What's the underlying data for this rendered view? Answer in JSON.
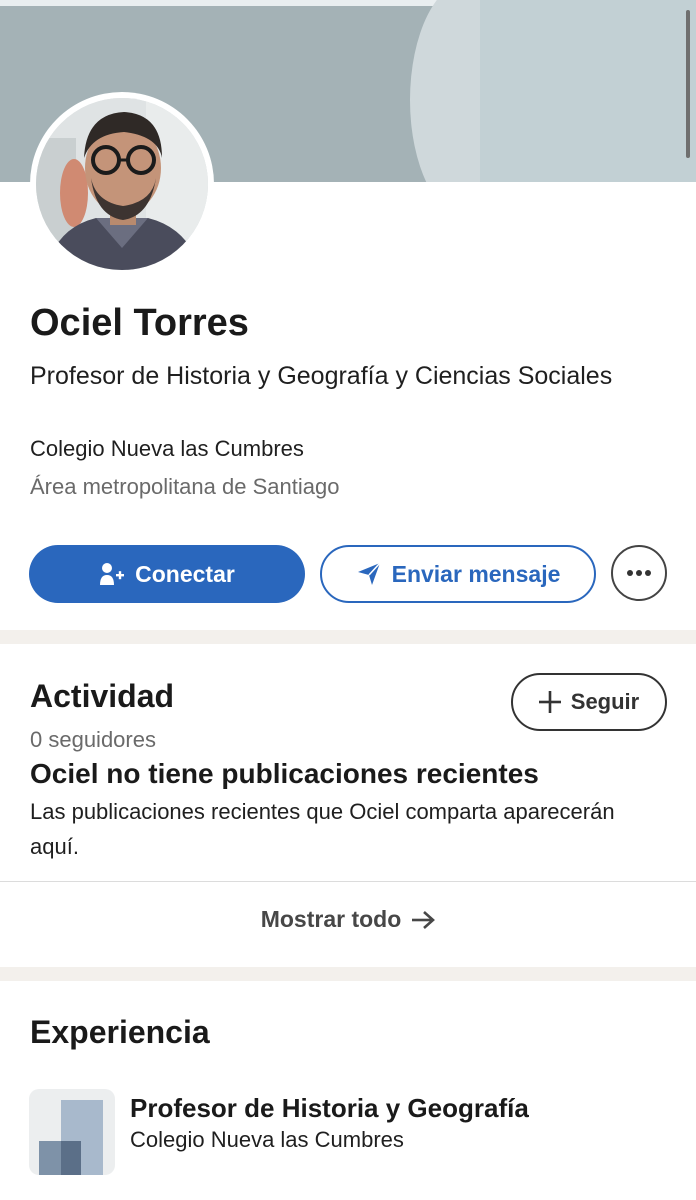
{
  "profile": {
    "name": "Ociel Torres",
    "headline": "Profesor de Historia y Geografía y Ciencias Sociales",
    "company": "Colegio Nueva las Cumbres",
    "location": "Área metropolitana de Santiago"
  },
  "actions": {
    "connect_label": "Conectar",
    "message_label": "Enviar mensaje",
    "more_icon": "ellipsis-icon"
  },
  "activity": {
    "title": "Actividad",
    "follow_label": "Seguir",
    "followers": "0 seguidores",
    "empty_title": "Ociel no tiene publicaciones recientes",
    "empty_desc": "Las publicaciones recientes que Ociel comparta aparecerán aquí.",
    "show_all_label": "Mostrar todo"
  },
  "experience": {
    "title": "Experiencia",
    "items": [
      {
        "role": "Profesor de Historia y Geografía",
        "company": "Colegio Nueva las Cumbres"
      }
    ]
  },
  "colors": {
    "accent": "#2a67bd",
    "banner": "#a4b2b6",
    "divider": "#f3f0ec"
  }
}
